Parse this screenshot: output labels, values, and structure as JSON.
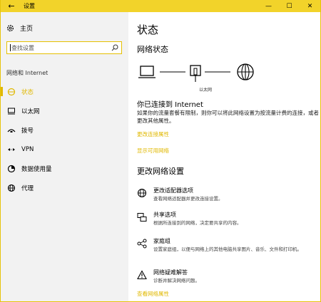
{
  "window": {
    "title": "设置",
    "back_glyph": "←",
    "minimize_glyph": "—",
    "maximize_glyph": "☐",
    "close_glyph": "✕"
  },
  "sidebar": {
    "home_label": "主页",
    "search_placeholder": "查找设置",
    "section_label": "网络和 Internet",
    "items": [
      {
        "label": "状态",
        "icon": "globe-status-icon",
        "active": true
      },
      {
        "label": "以太网",
        "icon": "ethernet-icon",
        "active": false
      },
      {
        "label": "拨号",
        "icon": "dialup-icon",
        "active": false
      },
      {
        "label": "VPN",
        "icon": "vpn-icon",
        "active": false
      },
      {
        "label": "数据使用量",
        "icon": "data-usage-icon",
        "active": false
      },
      {
        "label": "代理",
        "icon": "proxy-globe-icon",
        "active": false
      }
    ]
  },
  "main": {
    "title": "状态",
    "network_status_heading": "网络状态",
    "router_label": "以太网",
    "connected_title": "你已连接到 Internet",
    "connected_desc": "如果你的流量套餐有限制，则你可以将此网络设置为按流量计费的连接，或者更改其他属性。",
    "link_change_props": "更改连接属性",
    "link_show_networks": "显示可用网络",
    "change_settings_heading": "更改网络设置",
    "options": [
      {
        "title": "更改适配器选项",
        "desc": "查看网络适配器并更改连接设置。",
        "icon": "adapter-globe-icon"
      },
      {
        "title": "共享选项",
        "desc": "根据所连接到的网络，决定要共享的内容。",
        "icon": "sharing-icon"
      },
      {
        "title": "家庭组",
        "desc": "设置家庭组，以便与网络上的其他电脑共享图片、音乐、文件和打印机。",
        "icon": "homegroup-icon"
      },
      {
        "title": "网络疑难解答",
        "desc": "诊断并解决网络问题。",
        "icon": "warning-icon"
      }
    ],
    "link_view_props": "查看网络属性"
  },
  "colors": {
    "accent": "#e0b800",
    "titlebar": "#f2d32a"
  }
}
